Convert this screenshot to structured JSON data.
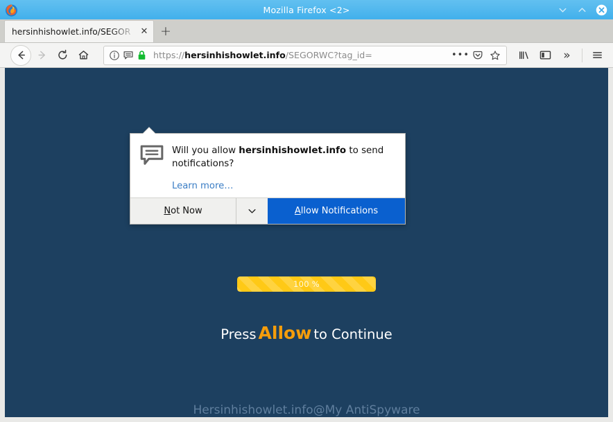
{
  "window": {
    "title": "Mozilla Firefox <2>",
    "controls": [
      {
        "name": "minimize-button",
        "glyph": "chevron-down"
      },
      {
        "name": "maximize-button",
        "glyph": "chevron-up"
      },
      {
        "name": "close-button",
        "glyph": "x-circle"
      }
    ]
  },
  "tabs": {
    "active": {
      "title": "hersinhishowlet.info/SEGOR",
      "close_label": "✕"
    },
    "new_tab_label": "+"
  },
  "toolbar": {
    "back_label": "←",
    "forward_label": "→",
    "reload_label": "↻",
    "home_label": "home-icon",
    "library_label": "library-icon",
    "sidebar_label": "sidebar-icon",
    "overflow_label": "»",
    "menu_label": "☰"
  },
  "urlbar": {
    "scheme": "https://",
    "host": "hersinhishowlet.info",
    "path": "/SEGORWC?tag_id=",
    "full_url": "https://hersinhishowlet.info/SEGORWC?tag_id=",
    "info_icon": "page-info-icon",
    "notification_icon": "notification-permission-icon",
    "lock_icon": "padlock-icon",
    "lock_color": "#12bb30",
    "page_actions_label": "•••",
    "pocket_label": "pocket-icon",
    "bookmark_label": "☆"
  },
  "permission_popup": {
    "icon": "speech-bubble-icon",
    "question_prefix": "Will you allow ",
    "question_host": "hersinhishowlet.info",
    "question_suffix": " to send notifications?",
    "learn_more": "Learn more…",
    "not_now_label": "Not Now",
    "not_now_accesskey": "N",
    "dropdown_label": "⌄",
    "allow_label": "Allow Notifications",
    "allow_accesskey": "A",
    "allow_bg": "#0a60cf"
  },
  "page": {
    "background_color": "#1d4060",
    "progress": {
      "percent_label": "100 %",
      "percent_value": 100,
      "bar_color": "#ffc916"
    },
    "press_prefix": "Press",
    "press_highlight": "Allow",
    "press_suffix": "to Continue",
    "highlight_color": "#f59d0b",
    "footer": "Hersinhishowlet.info@My AntiSpyware"
  }
}
